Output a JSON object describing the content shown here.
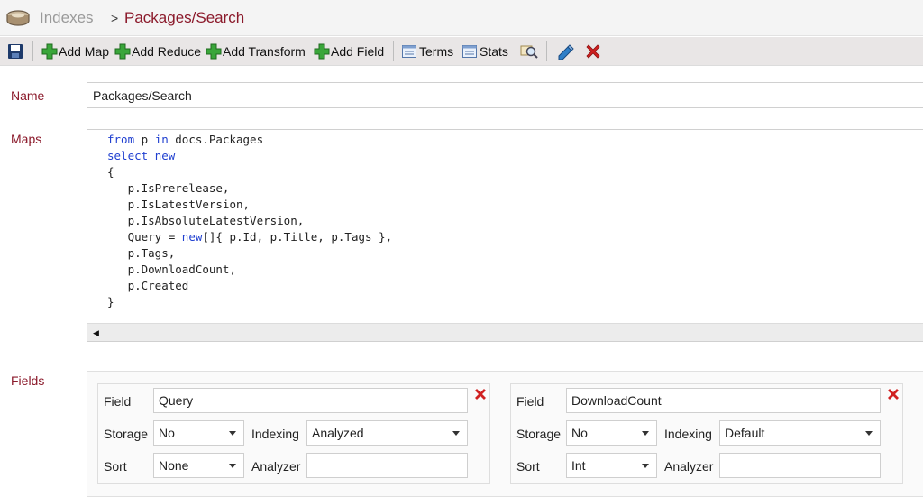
{
  "header": {
    "breadcrumb_root": "Indexes",
    "separator": ">",
    "current": "Packages/Search"
  },
  "toolbar": {
    "add_map": "Add Map",
    "add_reduce": "Add Reduce",
    "add_transform": "Add Transform",
    "add_field": "Add Field",
    "terms": "Terms",
    "stats": "Stats",
    "icons": [
      "save-icon",
      "plus-icon",
      "document-icon",
      "query-icon",
      "edit-icon",
      "delete-icon"
    ]
  },
  "form": {
    "name_label": "Name",
    "name_value": "Packages/Search",
    "maps_label": "Maps",
    "fields_label": "Fields"
  },
  "map_code": {
    "lines": [
      [
        {
          "t": "from",
          "k": 1
        },
        {
          "t": " p "
        },
        {
          "t": "in",
          "k": 1
        },
        {
          "t": " docs.Packages"
        }
      ],
      [
        {
          "t": "select",
          "k": 1
        },
        {
          "t": " "
        },
        {
          "t": "new",
          "k": 1
        }
      ],
      [
        {
          "t": "{"
        }
      ],
      [
        {
          "t": "   p.IsPrerelease,"
        }
      ],
      [
        {
          "t": "   p.IsLatestVersion,"
        }
      ],
      [
        {
          "t": "   p.IsAbsoluteLatestVersion,"
        }
      ],
      [
        {
          "t": "   Query = "
        },
        {
          "t": "new",
          "k": 1
        },
        {
          "t": "[]{ p.Id, p.Title, p.Tags },"
        }
      ],
      [
        {
          "t": "   p.Tags,"
        }
      ],
      [
        {
          "t": "   p.DownloadCount,"
        }
      ],
      [
        {
          "t": "   p.Created"
        }
      ],
      [
        {
          "t": "}"
        }
      ]
    ]
  },
  "fields": [
    {
      "field_label": "Field",
      "field_value": "Query",
      "storage_label": "Storage",
      "storage_value": "No",
      "indexing_label": "Indexing",
      "indexing_value": "Analyzed",
      "sort_label": "Sort",
      "sort_value": "None",
      "analyzer_label": "Analyzer",
      "analyzer_value": ""
    },
    {
      "field_label": "Field",
      "field_value": "DownloadCount",
      "storage_label": "Storage",
      "storage_value": "No",
      "indexing_label": "Indexing",
      "indexing_value": "Default",
      "sort_label": "Sort",
      "sort_value": "Int",
      "analyzer_label": "Analyzer",
      "analyzer_value": ""
    }
  ],
  "colors": {
    "accent": "#8b1a2b",
    "keyword": "#1f3fd0",
    "plus_green": "#3aa63a",
    "delete_red": "#d02020"
  }
}
